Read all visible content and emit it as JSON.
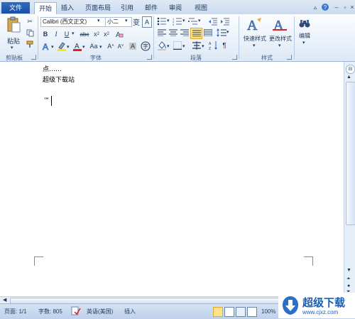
{
  "tabs": [
    {
      "label": "文件"
    },
    {
      "label": "开始"
    },
    {
      "label": "插入"
    },
    {
      "label": "页面布局"
    },
    {
      "label": "引用"
    },
    {
      "label": "邮件"
    },
    {
      "label": "审阅"
    },
    {
      "label": "视图"
    }
  ],
  "clipboard": {
    "paste_label": "粘贴",
    "group_label": "剪贴板"
  },
  "font": {
    "name_value": "Calibri (西文正文)",
    "size_value": "小二",
    "group_label": "字体"
  },
  "paragraph": {
    "group_label": "段落"
  },
  "styles": {
    "quick_label": "快速样式",
    "change_label": "更改样式",
    "group_label": "样式"
  },
  "editing": {
    "label": "编辑"
  },
  "document": {
    "lines": [
      "点……",
      "超级下载站"
    ],
    "tm_text": "™"
  },
  "status": {
    "page": "页面: 1/1",
    "words": "字数: 805",
    "language": "英语(美国)",
    "mode": "插入",
    "zoom": "100%"
  },
  "watermark": {
    "text": "超级下载",
    "url": "www.cjxz.com"
  },
  "colors": {
    "accent": "#2f6cc2",
    "highlight": "#ffe600",
    "font_red": "#e02020"
  }
}
